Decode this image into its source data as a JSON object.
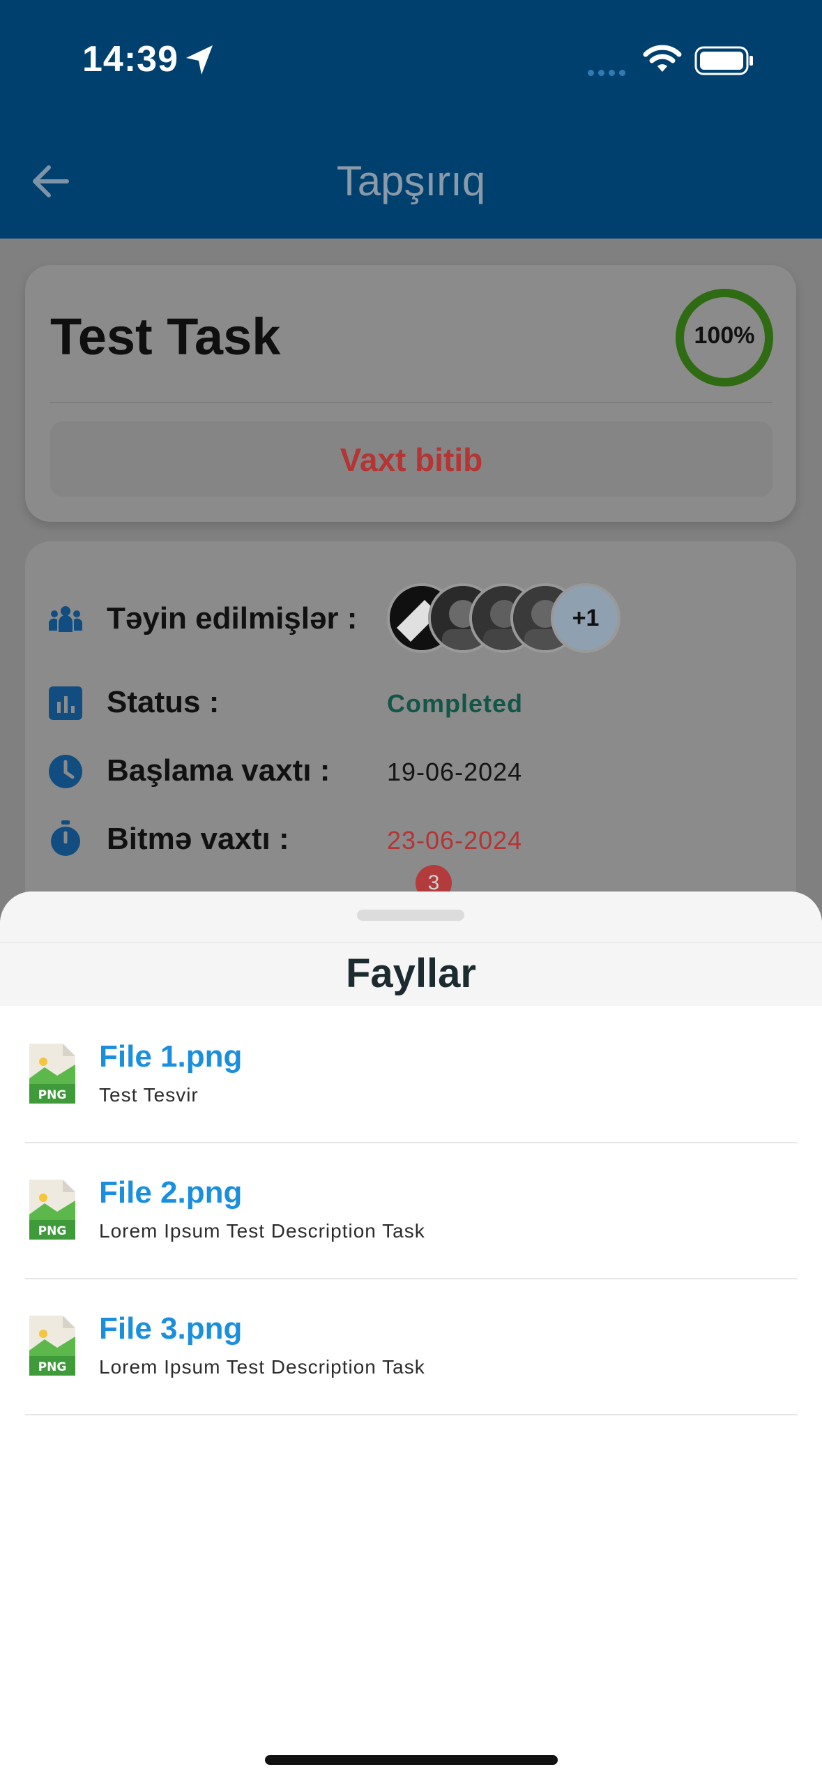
{
  "status_bar": {
    "time": "14:39"
  },
  "header": {
    "title": "Tapşırıq"
  },
  "task": {
    "title": "Test Task",
    "progress_label": "100%",
    "progress_value": 1.0,
    "deadline_status": "Vaxt bitib"
  },
  "details": {
    "assignees_label": "Təyin edilmişlər :",
    "assignees_more": "+1",
    "status_label": "Status :",
    "status_value": "Completed",
    "start_label": "Başlama vaxtı :",
    "start_value": "19-06-2024",
    "end_label": "Bitmə vaxtı :",
    "end_value": "23-06-2024",
    "files_badge": "3"
  },
  "sheet": {
    "title": "Fayllar",
    "files": [
      {
        "name": "File 1.png",
        "description": "Test Tesvir",
        "type": "PNG"
      },
      {
        "name": "File 2.png",
        "description": "Lorem Ipsum Test Description Task",
        "type": "PNG"
      },
      {
        "name": "File 3.png",
        "description": "Lorem Ipsum Test Description Task",
        "type": "PNG"
      }
    ]
  },
  "colors": {
    "header_bg": "#00406f",
    "progress_ring": "#2e6b12",
    "expired_text": "#b53434",
    "status_text": "#135647",
    "file_name": "#1a8fe0",
    "icon_blue": "#114d80"
  }
}
